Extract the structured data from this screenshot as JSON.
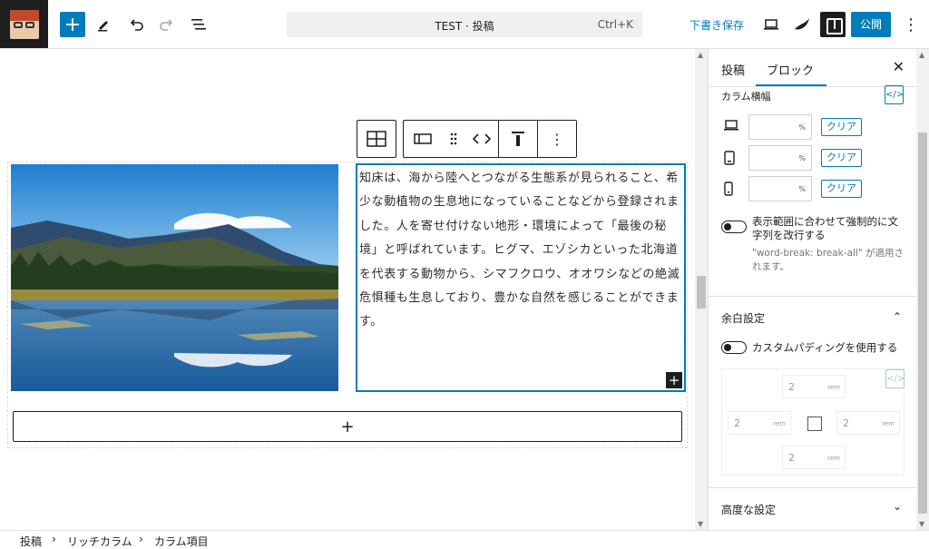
{
  "topbar": {
    "document_title": "TEST · 投稿",
    "shortcut": "Ctrl+K",
    "save_draft": "下書き保存",
    "publish": "公開"
  },
  "content": {
    "paragraph": "知床は、海から陸へとつながる生態系が見られること、希少な動植物の生息地になっていることなどから登録されました。人を寄せ付けない地形・環境によって「最後の秘境」と呼ばれています。ヒグマ、エゾシカといった北海道を代表する動物から、シマフクロウ、オオワシなどの絶滅危惧種も生息しており、豊かな自然を感じることができます。",
    "appender_symbol": "+"
  },
  "sidebar": {
    "tab_post": "投稿",
    "tab_block": "ブロック",
    "column_width_label": "カラム横幅",
    "unit": "%",
    "clear_label": "クリア",
    "word_break_toggle": "表示範囲に合わせて強制的に文字列を改行する",
    "word_break_help": "\"word-break: break-all\" が適用されます。",
    "spacing_title": "余白設定",
    "custom_padding_toggle": "カスタムパディングを使用する",
    "padding_value": "2",
    "padding_unit": "rem",
    "advanced_title": "高度な設定"
  },
  "breadcrumb": {
    "items": [
      "投稿",
      "リッチカラム",
      "カラム項目"
    ]
  },
  "colors": {
    "accent": "#007cba",
    "dark": "#1e1e1e"
  }
}
